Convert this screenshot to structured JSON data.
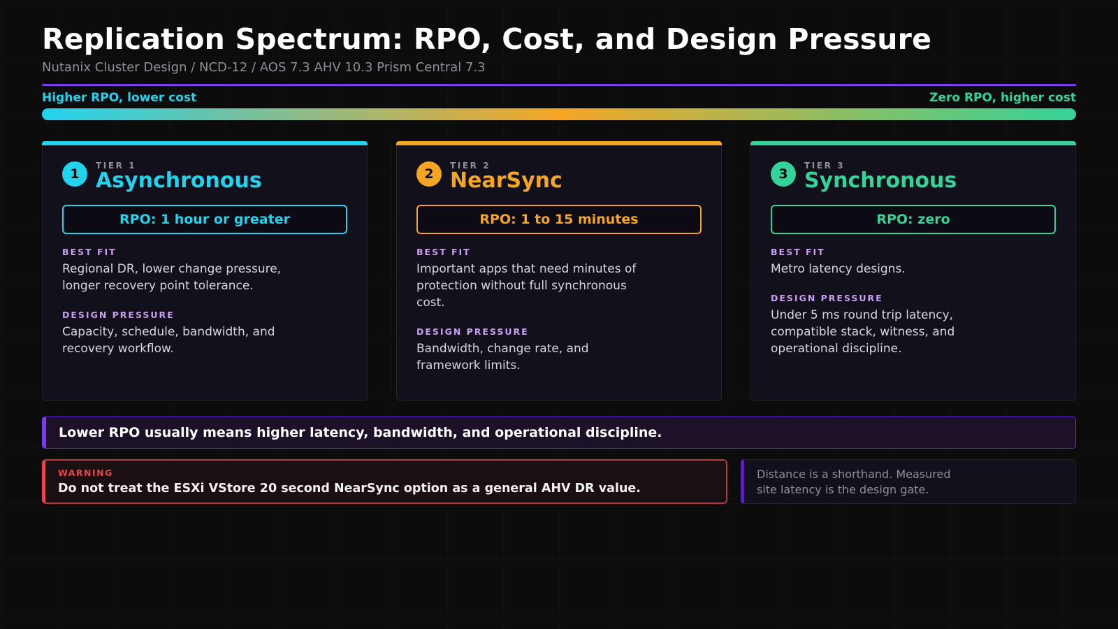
{
  "header": {
    "title": "Replication Spectrum: RPO, Cost, and Design Pressure",
    "subtitle": "Nutanix Cluster Design / NCD-12 / AOS 7.3 AHV 10.3 Prism Central 7.3"
  },
  "spectrum": {
    "left_label": "Higher RPO, lower cost",
    "right_label": "Zero RPO, higher cost",
    "gradient_colors": [
      "#22d3ee",
      "#f5a524",
      "#34d399"
    ]
  },
  "tiers": [
    {
      "number": "1",
      "kicker": "TIER 1",
      "name": "Asynchronous",
      "color": "#22d3ee",
      "rpo": "RPO: 1 hour or greater",
      "best_fit_label": "BEST FIT",
      "best_fit": "Regional DR, lower change pressure, longer recovery point tolerance.",
      "pressure_label": "DESIGN PRESSURE",
      "pressure": "Capacity, schedule, bandwidth, and recovery workflow."
    },
    {
      "number": "2",
      "kicker": "TIER 2",
      "name": "NearSync",
      "color": "#f5a524",
      "rpo": "RPO: 1 to 15 minutes",
      "best_fit_label": "BEST FIT",
      "best_fit": "Important apps that need minutes of protection without full synchronous cost.",
      "pressure_label": "DESIGN PRESSURE",
      "pressure": "Bandwidth, change rate, and framework limits."
    },
    {
      "number": "3",
      "kicker": "TIER 3",
      "name": "Synchronous",
      "color": "#34d399",
      "rpo": "RPO: zero",
      "best_fit_label": "BEST FIT",
      "best_fit": "Metro latency designs.",
      "pressure_label": "DESIGN PRESSURE",
      "pressure": "Under 5 ms round trip latency, compatible stack, witness, and operational discipline."
    }
  ],
  "tradeoff": "Lower RPO usually means higher latency, bandwidth, and operational discipline.",
  "warning": {
    "label": "WARNING",
    "text": "Do not treat the ESXi VStore 20 second NearSync option as a general AHV DR value."
  },
  "note": "Distance is a shorthand. Measured site latency is the design gate."
}
